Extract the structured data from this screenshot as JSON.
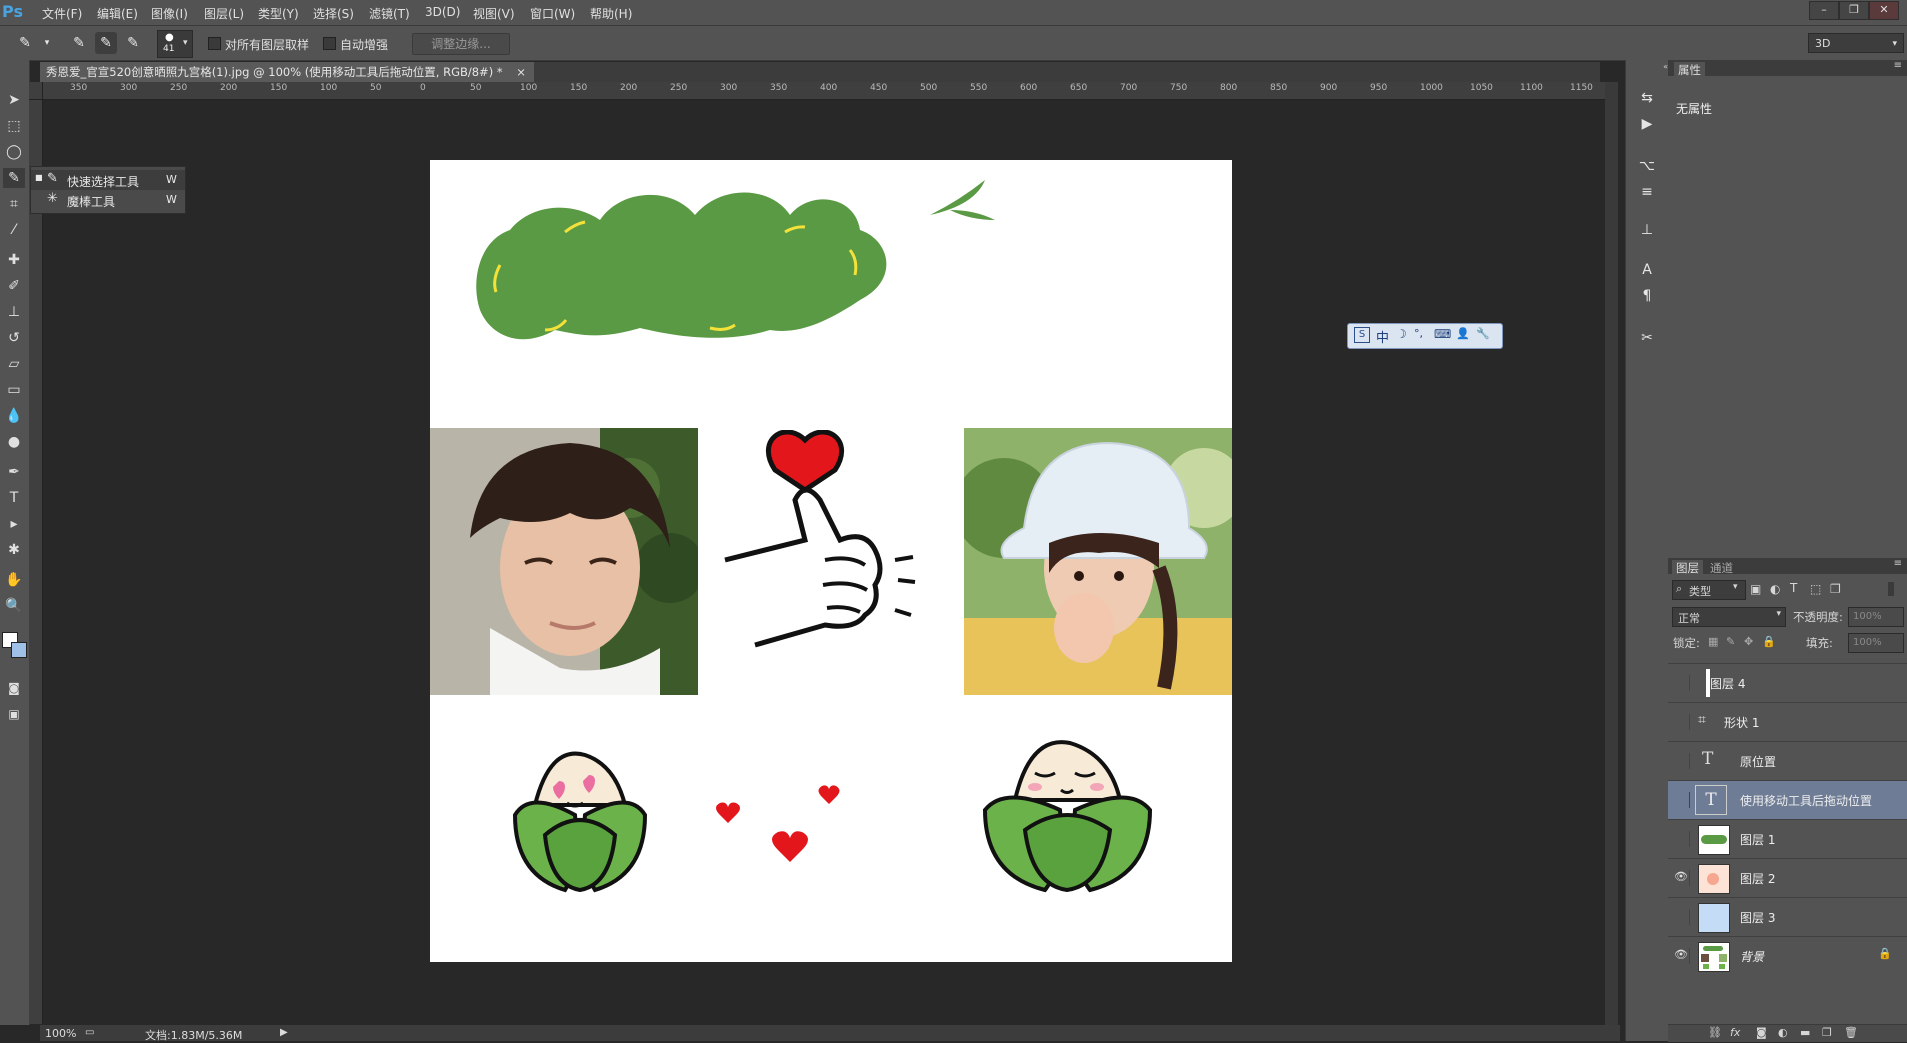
{
  "app": {
    "logo": "Ps"
  },
  "menu": [
    "文件(F)",
    "编辑(E)",
    "图像(I)",
    "图层(L)",
    "类型(Y)",
    "选择(S)",
    "滤镜(T)",
    "3D(D)",
    "视图(V)",
    "窗口(W)",
    "帮助(H)"
  ],
  "window_controls": {
    "minimize": "–",
    "restore": "❐",
    "close": "✕"
  },
  "options": {
    "brush_size": "41",
    "sample_all_layers": "对所有图层取样",
    "auto_enhance": "自动增强",
    "refine_edge": "调整边缘...",
    "workspace": "3D"
  },
  "document_tab": {
    "title": "秀恩爱_官宣520创意晒照九宫格(1).jpg @ 100% (使用移动工具后拖动位置, RGB/8#) *",
    "close": "×"
  },
  "ruler": {
    "top_labels": [
      "350",
      "300",
      "250",
      "200",
      "150",
      "100",
      "50",
      "0",
      "50",
      "100",
      "150",
      "200",
      "250",
      "300",
      "350",
      "400",
      "450",
      "500",
      "550",
      "600",
      "650",
      "700",
      "750",
      "800",
      "850",
      "900",
      "950",
      "1000",
      "1050",
      "1100",
      "1150"
    ]
  },
  "flyout": {
    "items": [
      {
        "label": "快速选择工具",
        "shortcut": "W",
        "icon": "quick-selection-icon"
      },
      {
        "label": "魔棒工具",
        "shortcut": "W",
        "icon": "magic-wand-icon"
      }
    ]
  },
  "ime_toolbar": {
    "items": [
      "中",
      "☽",
      "°,",
      "⌨",
      "👤",
      "🔧"
    ]
  },
  "status": {
    "zoom": "100%",
    "doc_size": "文档:1.83M/5.36M"
  },
  "properties_panel": {
    "tab": "属性",
    "content": "无属性"
  },
  "layers_panel": {
    "tabs": [
      "图层",
      "通道"
    ],
    "filter": "类型",
    "blend_mode": "正常",
    "opacity_label": "不透明度:",
    "opacity_value": "100%",
    "lock_label": "锁定:",
    "fill_label": "填充:",
    "fill_value": "100%",
    "layers": [
      {
        "name": "图层 4",
        "visible": false,
        "kind": "pixel",
        "selected": false
      },
      {
        "name": "形状 1",
        "visible": false,
        "kind": "shape",
        "selected": false
      },
      {
        "name": "原位置",
        "visible": false,
        "kind": "text",
        "selected": false
      },
      {
        "name": "使用移动工具后拖动位置",
        "visible": false,
        "kind": "text",
        "selected": true
      },
      {
        "name": "图层 1",
        "visible": false,
        "kind": "pixel",
        "selected": false
      },
      {
        "name": "图层 2",
        "visible": true,
        "kind": "pixel",
        "selected": false
      },
      {
        "name": "图层 3",
        "visible": false,
        "kind": "pixel",
        "selected": false
      },
      {
        "name": "背景",
        "visible": true,
        "kind": "background",
        "selected": false,
        "locked": true
      }
    ]
  }
}
